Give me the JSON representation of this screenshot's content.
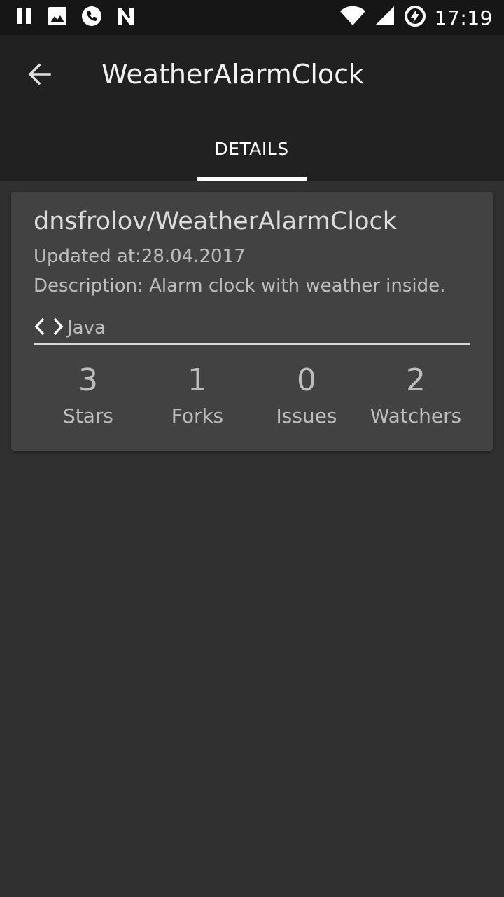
{
  "status_bar": {
    "time": "17:19",
    "left_icons": [
      "pause-icon",
      "image-icon",
      "phone-icon",
      "n-icon"
    ],
    "right_icons": [
      "wifi-icon",
      "signal-icon",
      "battery-charging-icon"
    ]
  },
  "app_bar": {
    "title": "WeatherAlarmClock",
    "back_icon": "arrow-back-icon"
  },
  "tabs": [
    {
      "label": "DETAILS",
      "selected": true
    }
  ],
  "repo": {
    "full_name": "dnsfrolov/WeatherAlarmClock",
    "updated": "Updated at:28.04.2017",
    "description": "Description: Alarm clock with weather inside.",
    "language": "Java",
    "language_icon": "code-icon",
    "stats": [
      {
        "value": "3",
        "label": "Stars"
      },
      {
        "value": "1",
        "label": "Forks"
      },
      {
        "value": "0",
        "label": "Issues"
      },
      {
        "value": "2",
        "label": "Watchers"
      }
    ]
  },
  "colors": {
    "background": "#303030",
    "app_bar": "#212121",
    "status_bar": "#161616",
    "card": "#424242",
    "secondary_text": "#bdbdbd"
  }
}
